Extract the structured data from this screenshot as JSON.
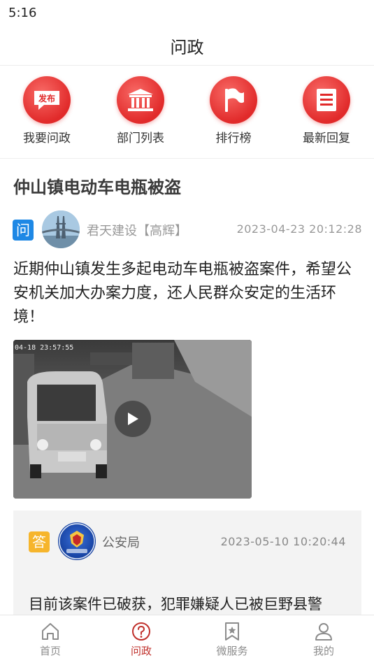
{
  "status_bar": {
    "time": "5:16"
  },
  "header": {
    "title": "问政"
  },
  "shortcuts": [
    {
      "label": "我要问政",
      "icon": "publish-icon",
      "icon_text": "发布"
    },
    {
      "label": "部门列表",
      "icon": "government-building-icon"
    },
    {
      "label": "排行榜",
      "icon": "flag-icon"
    },
    {
      "label": "最新回复",
      "icon": "document-list-icon"
    }
  ],
  "post": {
    "title": "仲山镇电动车电瓶被盗",
    "ask_tag": "问",
    "author": "君天建设【高辉】",
    "time": "2023-04-23  20:12:28",
    "content": "近期仲山镇发生多起电动车电瓶被盗案件，希望公安机关加大办案力度，还人民群众安定的生活环境！",
    "video": {
      "timestamp": "04-18 23:57:55"
    }
  },
  "reply": {
    "tag": "答",
    "author": "公安局",
    "time": "2023-05-10  10:20:44",
    "content": "目前该案件已破获，犯罪嫌疑人已被巨野县警"
  },
  "tabbar": {
    "tabs": [
      {
        "label": "首页",
        "icon": "home-icon",
        "active": false
      },
      {
        "label": "问政",
        "icon": "question-icon",
        "active": true
      },
      {
        "label": "微服务",
        "icon": "star-bookmark-icon",
        "active": false
      },
      {
        "label": "我的",
        "icon": "user-icon",
        "active": false
      }
    ]
  },
  "colors": {
    "accent": "#e12a2a",
    "active_tab": "#c0302b",
    "ask_tag": "#1e88e5",
    "reply_tag": "#f6b52c"
  }
}
